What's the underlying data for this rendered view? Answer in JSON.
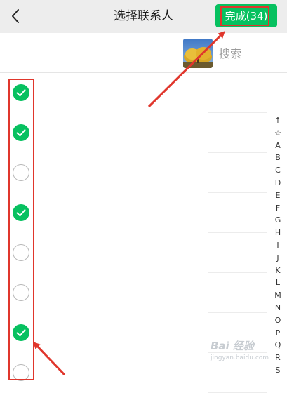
{
  "header": {
    "title": "选择联系人",
    "done_label": "完成(34)",
    "accent": "#07c160",
    "back_icon": "chevron-left-icon"
  },
  "search": {
    "placeholder": "搜索"
  },
  "contacts": [
    {
      "checked": true
    },
    {
      "checked": true
    },
    {
      "checked": false
    },
    {
      "checked": true
    },
    {
      "checked": false
    },
    {
      "checked": false
    },
    {
      "checked": true
    },
    {
      "checked": false
    }
  ],
  "index_letters": [
    "↑",
    "☆",
    "A",
    "B",
    "C",
    "D",
    "E",
    "F",
    "G",
    "H",
    "I",
    "J",
    "K",
    "L",
    "M",
    "N",
    "O",
    "P",
    "Q",
    "R",
    "S"
  ],
  "annotation": {
    "color": "#e0362c"
  },
  "watermark": {
    "brand": "Bai 经验",
    "site": "jingyan.baidu.com"
  }
}
